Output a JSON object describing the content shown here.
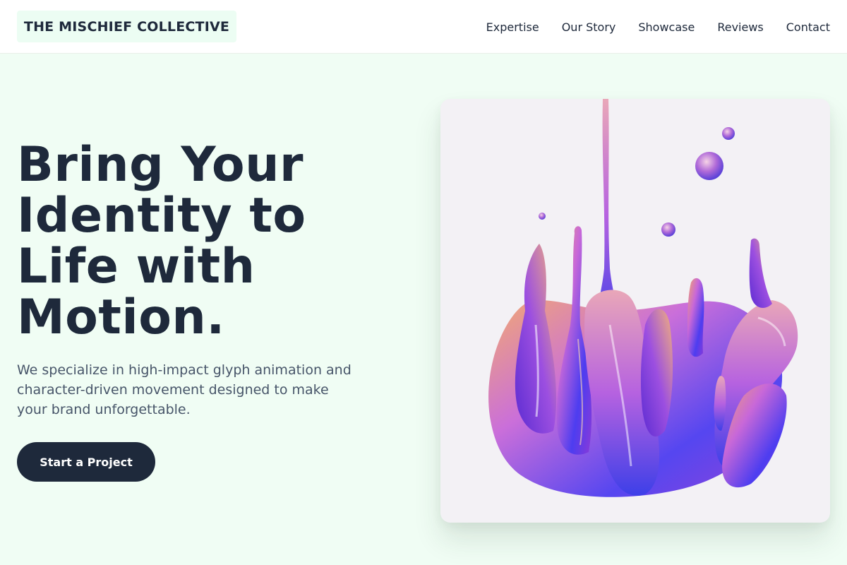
{
  "brand": {
    "name": "THE MISCHIEF COLLECTIVE"
  },
  "nav": {
    "items": [
      {
        "label": "Expertise"
      },
      {
        "label": "Our Story"
      },
      {
        "label": "Showcase"
      },
      {
        "label": "Reviews"
      },
      {
        "label": "Contact"
      }
    ]
  },
  "hero": {
    "title_lines": [
      "Bring Your",
      "Identity to",
      "Life with",
      "Motion."
    ],
    "subtitle_lines": [
      "We specialize in high-impact glyph animation and",
      "character-driven movement designed to make",
      "your brand unforgettable."
    ],
    "cta_label": "Start a Project"
  },
  "media": {
    "icon": "liquid-glass-splash-image"
  },
  "colors": {
    "page_bg": "#f0fdf4",
    "header_bg": "#ffffff",
    "logo_bg": "#ecfdf3",
    "text_dark": "#1e293b",
    "text_muted": "#475569",
    "cta_bg": "#1e293b",
    "card_bg": "#f3f1f5"
  }
}
